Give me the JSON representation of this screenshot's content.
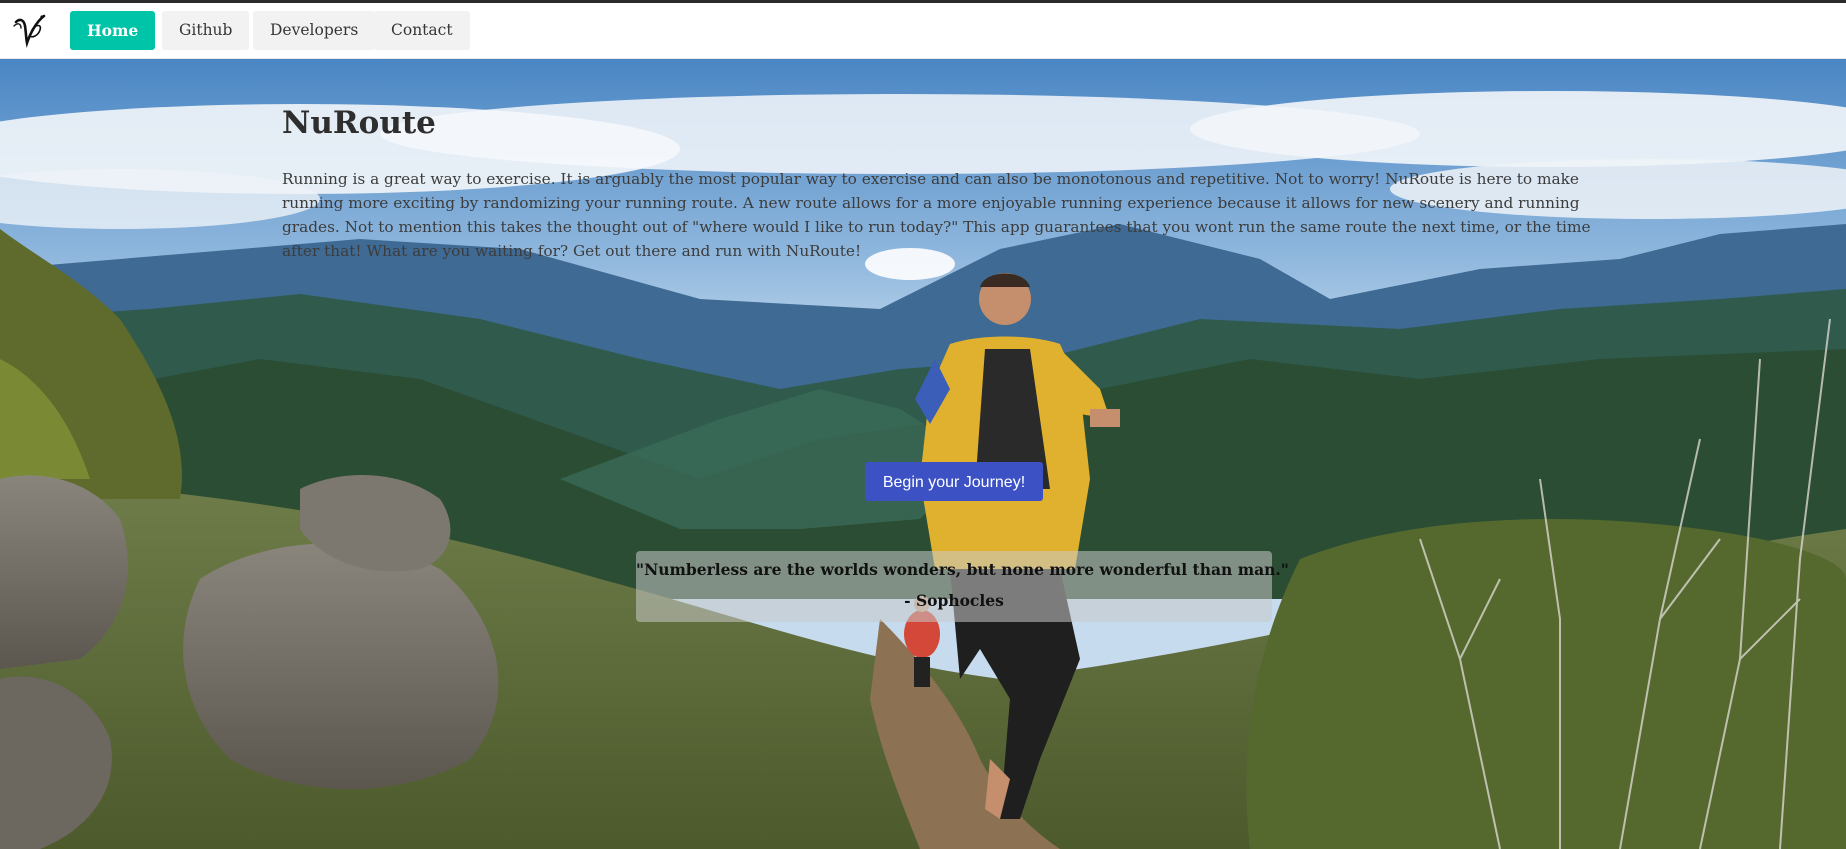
{
  "nav": {
    "logo_icon": "v-signature-logo-icon",
    "items": [
      {
        "label": "Home",
        "active": true
      },
      {
        "label": "Github",
        "active": false
      },
      {
        "label": "Developers",
        "active": false
      },
      {
        "label": "Contact",
        "active": false
      }
    ]
  },
  "hero": {
    "title": "NuRoute",
    "description": "Running is a great way to exercise. It is arguably the most popular way to exercise and can also be monotonous and repetitive. Not to worry! NuRoute is here to make running more exciting by randomizing your running route. A new route allows for a more enjoyable running experience because it allows for new scenery and running grades. Not to mention this takes the thought out of \"where would I like to run today?\" This app guarantees that you wont run the same route the next time, or the time after that! What are you waiting for? Get out there and run with NuRoute!",
    "cta_label": "Begin your Journey!",
    "background": "mountain-trail-runner-photo",
    "quote": {
      "text": "\"Numberless are the worlds wonders, but none more wonderful than man.\"",
      "author": "- Sophocles"
    }
  },
  "colors": {
    "accent": "#00c4a7",
    "cta": "#3c51c4",
    "nav_bg": "#f2f2f2"
  }
}
